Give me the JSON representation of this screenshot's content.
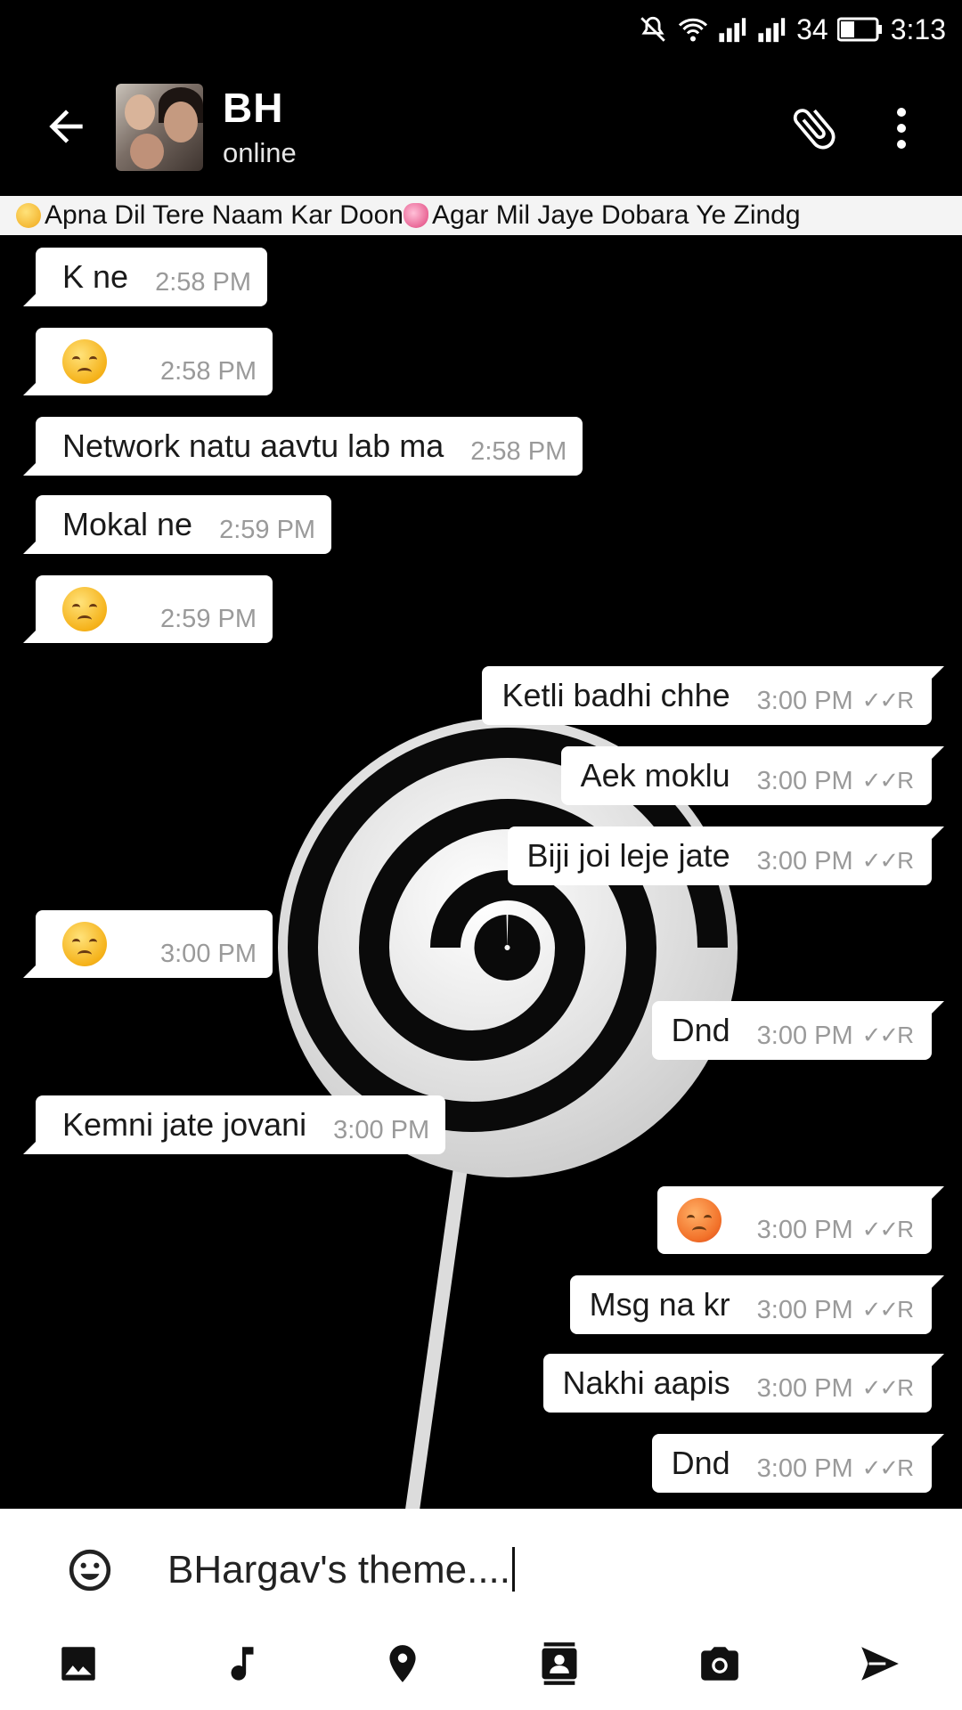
{
  "status_bar": {
    "battery": "34",
    "time": "3:13"
  },
  "header": {
    "title": "BH",
    "subtitle": "online"
  },
  "marquee": {
    "text": "Apna Dil Tere Naam Kar Doon",
    "text2": "Agar Mil Jaye Dobara Ye Zindg"
  },
  "messages": [
    {
      "dir": "in",
      "text": "K ne",
      "time": "2:58 PM"
    },
    {
      "dir": "in",
      "emoji": "disappointed-face",
      "time": "2:58 PM"
    },
    {
      "dir": "in",
      "text": "Network natu aavtu lab ma",
      "time": "2:58 PM"
    },
    {
      "dir": "in",
      "text": "Mokal ne",
      "time": "2:59 PM"
    },
    {
      "dir": "in",
      "emoji": "pensive-face",
      "time": "2:59 PM"
    },
    {
      "dir": "out",
      "text": "Ketli badhi chhe",
      "time": "3:00 PM",
      "status": "✓✓R"
    },
    {
      "dir": "out",
      "text": "Aek moklu",
      "time": "3:00 PM",
      "status": "✓✓R"
    },
    {
      "dir": "out",
      "text": "Biji joi leje jate",
      "time": "3:00 PM",
      "status": "✓✓R"
    },
    {
      "dir": "in",
      "emoji": "disappointed-face",
      "time": "3:00 PM"
    },
    {
      "dir": "out",
      "text": "Dnd",
      "time": "3:00 PM",
      "status": "✓✓R"
    },
    {
      "dir": "in",
      "text": "Kemni jate jovani",
      "time": "3:00 PM"
    },
    {
      "dir": "out",
      "emoji": "angry-face",
      "time": "3:00 PM",
      "status": "✓✓R"
    },
    {
      "dir": "out",
      "text": "Msg na kr",
      "time": "3:00 PM",
      "status": "✓✓R"
    },
    {
      "dir": "out",
      "text": "Nakhi aapis",
      "time": "3:00 PM",
      "status": "✓✓R"
    },
    {
      "dir": "out",
      "text": "Dnd",
      "time": "3:00 PM",
      "status": "✓✓R"
    }
  ],
  "composer": {
    "value": "BHargav's theme...."
  },
  "toolbar_icons": [
    "image-icon",
    "music-icon",
    "location-icon",
    "contact-icon",
    "camera-icon",
    "send-icon"
  ],
  "colors": {
    "background": "#000000",
    "bubble": "#ffffff",
    "time": "#9a9a9a"
  }
}
